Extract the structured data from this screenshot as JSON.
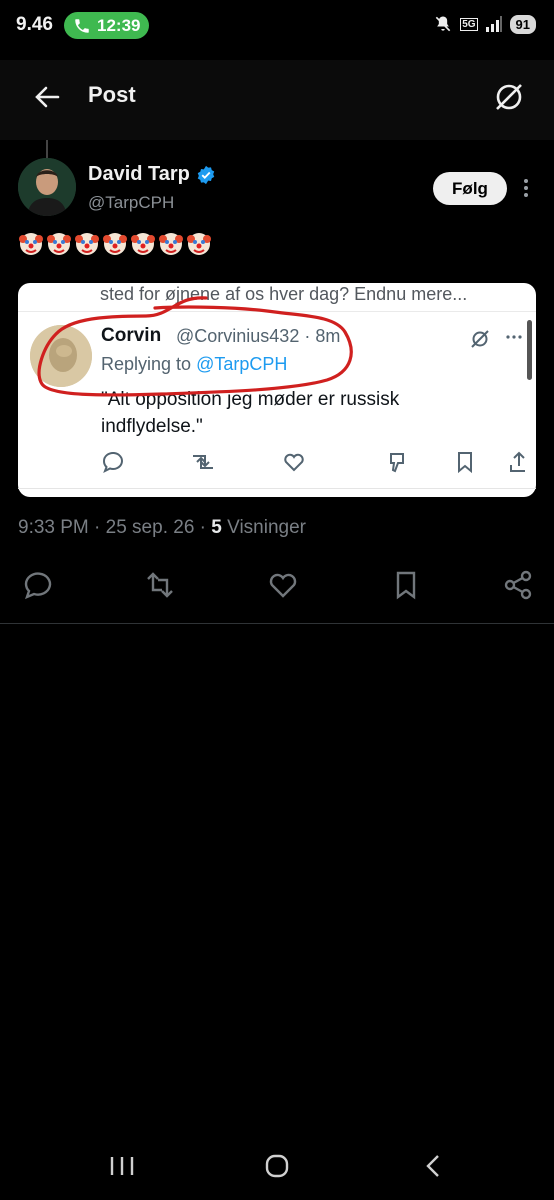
{
  "status_bar": {
    "time": "9.46",
    "call_time": "12:39",
    "network": "5G",
    "battery": "91"
  },
  "header": {
    "title": "Post"
  },
  "post": {
    "author_name": "David Tarp",
    "author_handle": "@TarpCPH",
    "follow_label": "Følg",
    "emoji_text": "🤡🤡🤡🤡🤡🤡🤡",
    "timestamp": "9:33 PM · 25 sep. 26 · ",
    "views_count": "5",
    "views_label": " Visninger"
  },
  "embedded_screenshot": {
    "cut_text": "sted for øjnene af os hver dag? Endnu mere...",
    "name": "Corvin",
    "handle_time": "@Corvinius432 · 8m",
    "replying_prefix": "Replying to ",
    "replying_mention": "@TarpCPH",
    "text_line1": "\"Alt opposition jeg møder er russisk",
    "text_line2": "indflydelse.\"",
    "annotation_color": "#d0201f"
  },
  "colors": {
    "verified": "#1d9bf0",
    "call_pill": "#3fb950"
  }
}
